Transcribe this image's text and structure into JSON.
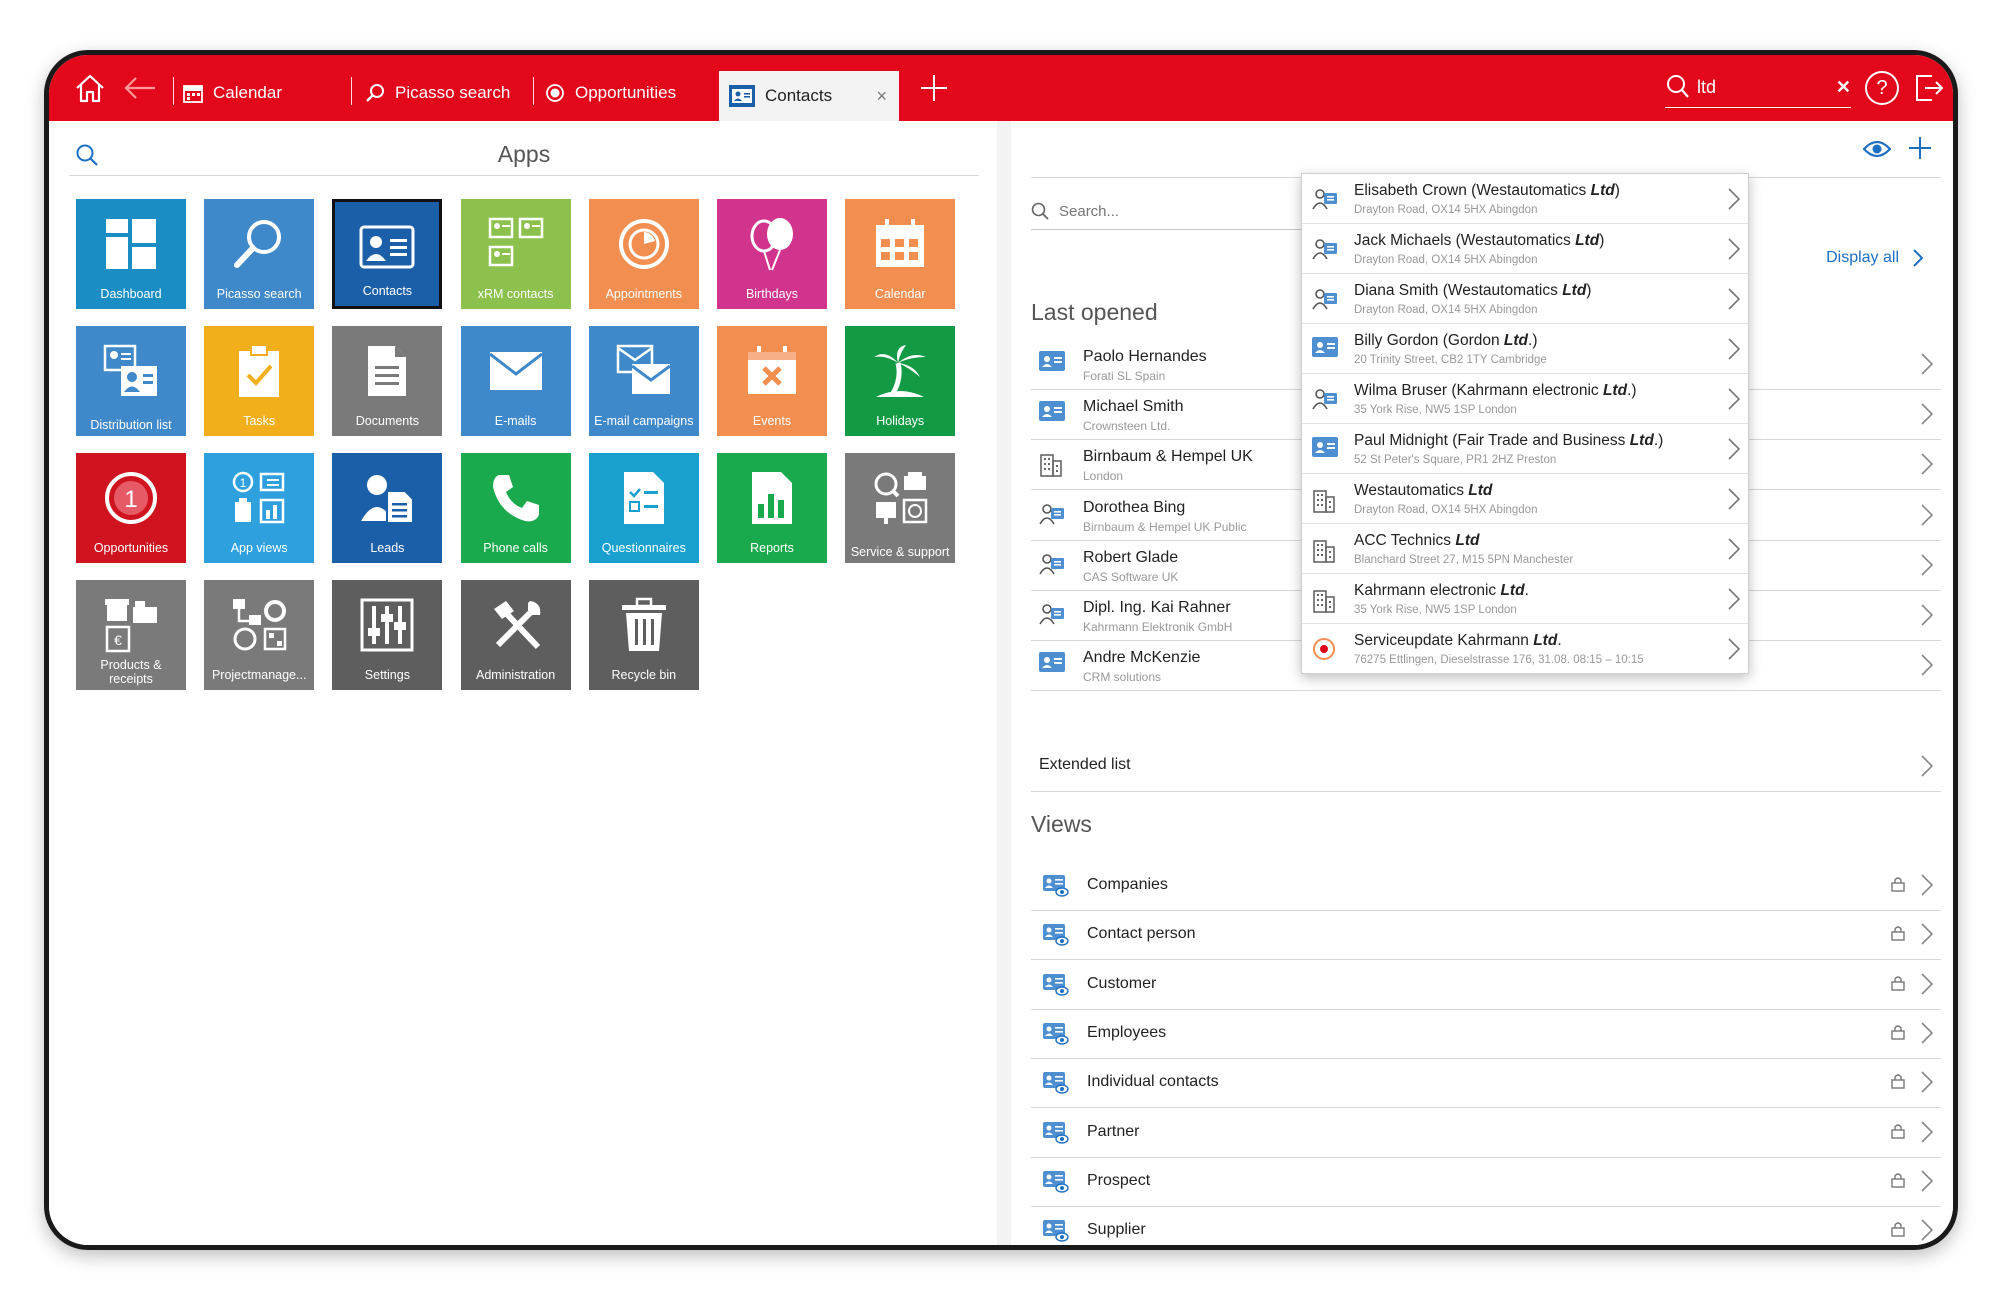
{
  "topbar": {
    "tabs": [
      {
        "label": "Calendar",
        "icon": "calendar-icon"
      },
      {
        "label": "Picasso search",
        "icon": "search-icon"
      },
      {
        "label": "Opportunities",
        "icon": "target-icon"
      },
      {
        "label": "Contacts",
        "icon": "contact-card-icon"
      }
    ],
    "active_tab_close": "×",
    "search_value": "ltd",
    "clear_symbol": "✕",
    "help_symbol": "?"
  },
  "apps": {
    "title": "Apps",
    "tiles": [
      {
        "label": "Dashboard",
        "color": "#1a8dc4"
      },
      {
        "label": "Picasso search",
        "color": "#3f88c9"
      },
      {
        "label": "Contacts",
        "color": "#1b5fa8"
      },
      {
        "label": "xRM contacts",
        "color": "#8cc14d"
      },
      {
        "label": "Appointments",
        "color": "#f28e4f"
      },
      {
        "label": "Birthdays",
        "color": "#d1348c"
      },
      {
        "label": "Calendar",
        "color": "#f28e4f"
      },
      {
        "label": "Distribution list",
        "color": "#3f88c9"
      },
      {
        "label": "Tasks",
        "color": "#f3ae1b"
      },
      {
        "label": "Documents",
        "color": "#7a7a7a"
      },
      {
        "label": "E-mails",
        "color": "#3f88c9"
      },
      {
        "label": "E-mail campaigns",
        "color": "#3f88c9"
      },
      {
        "label": "Events",
        "color": "#f28e4f"
      },
      {
        "label": "Holidays",
        "color": "#129a44"
      },
      {
        "label": "Opportunities",
        "color": "#d0141f"
      },
      {
        "label": "App views",
        "color": "#2ea0de"
      },
      {
        "label": "Leads",
        "color": "#1b5fa8"
      },
      {
        "label": "Phone calls",
        "color": "#1aa94d"
      },
      {
        "label": "Questionnaires",
        "color": "#1aa0cf"
      },
      {
        "label": "Reports",
        "color": "#1aa94d"
      },
      {
        "label": "Service & support",
        "color": "#7a7a7a"
      },
      {
        "label": "Products & receipts",
        "color": "#7a7a7a"
      },
      {
        "label": "Projectmanage...",
        "color": "#7a7a7a"
      },
      {
        "label": "Settings",
        "color": "#5e5e5e"
      },
      {
        "label": "Administration",
        "color": "#5e5e5e"
      },
      {
        "label": "Recycle bin",
        "color": "#5e5e5e"
      }
    ]
  },
  "contacts": {
    "search_placeholder": "Search...",
    "display_all": "Display all",
    "last_opened_title": "Last opened",
    "last_opened": [
      {
        "name": "Paolo Hernandes",
        "sub": "Forati SL Spain",
        "type": "card"
      },
      {
        "name": "Michael Smith",
        "sub": "Crownsteen Ltd.",
        "type": "card"
      },
      {
        "name": "Birnbaum & Hempel UK",
        "sub": "London",
        "type": "building"
      },
      {
        "name": "Dorothea Bing",
        "sub": "Birnbaum & Hempel UK Public",
        "type": "person"
      },
      {
        "name": "Robert Glade",
        "sub": "CAS Software UK",
        "type": "person"
      },
      {
        "name": "Dipl. Ing. Kai Rahner",
        "sub": "Kahrmann Elektronik GmbH",
        "type": "person"
      },
      {
        "name": "Andre McKenzie",
        "sub": "CRM solutions",
        "type": "card"
      }
    ],
    "extended_list": "Extended list",
    "views_title": "Views",
    "views": [
      "Companies",
      "Contact person",
      "Customer",
      "Employees",
      "Individual contacts",
      "Partner",
      "Prospect",
      "Supplier"
    ]
  },
  "dropdown": [
    {
      "pre": "Elisabeth Crown (Westautomatics ",
      "bold": "Ltd",
      "post": ")",
      "sub": "Drayton Road, OX14 5HX Abingdon",
      "type": "person"
    },
    {
      "pre": "Jack Michaels (Westautomatics ",
      "bold": "Ltd",
      "post": ")",
      "sub": "Drayton Road, OX14 5HX Abingdon",
      "type": "person"
    },
    {
      "pre": "Diana Smith (Westautomatics ",
      "bold": "Ltd",
      "post": ")",
      "sub": "Drayton Road, OX14 5HX Abingdon",
      "type": "person"
    },
    {
      "pre": "Billy Gordon (Gordon ",
      "bold": "Ltd",
      "post": ".)",
      "sub": "20 Trinity Street, CB2 1TY Cambridge",
      "type": "card"
    },
    {
      "pre": "Wilma Bruser (Kahrmann electronic ",
      "bold": "Ltd",
      "post": ".)",
      "sub": "35 York Rise, NW5 1SP London",
      "type": "person"
    },
    {
      "pre": "Paul Midnight (Fair Trade and Business ",
      "bold": "Ltd",
      "post": ".)",
      "sub": "52 St Peter's Square, PR1 2HZ Preston",
      "type": "card"
    },
    {
      "pre": "Westautomatics ",
      "bold": "Ltd",
      "post": "",
      "sub": "Drayton Road, OX14 5HX Abingdon",
      "type": "building"
    },
    {
      "pre": "ACC Technics ",
      "bold": "Ltd",
      "post": "",
      "sub": "Blanchard Street 27, M15 5PN Manchester",
      "type": "building"
    },
    {
      "pre": "Kahrmann electronic ",
      "bold": "Ltd",
      "post": ".",
      "sub": "35 York Rise, NW5 1SP London",
      "type": "building"
    },
    {
      "pre": "Serviceupdate Kahrmann ",
      "bold": "Ltd",
      "post": ".",
      "sub": "76275 Ettlingen, Dieselstrasse 176, 31.08. 08:15 – 10:15",
      "type": "appointment"
    }
  ],
  "colors": {
    "brand": "#e2071b",
    "link": "#1d6fc2"
  }
}
